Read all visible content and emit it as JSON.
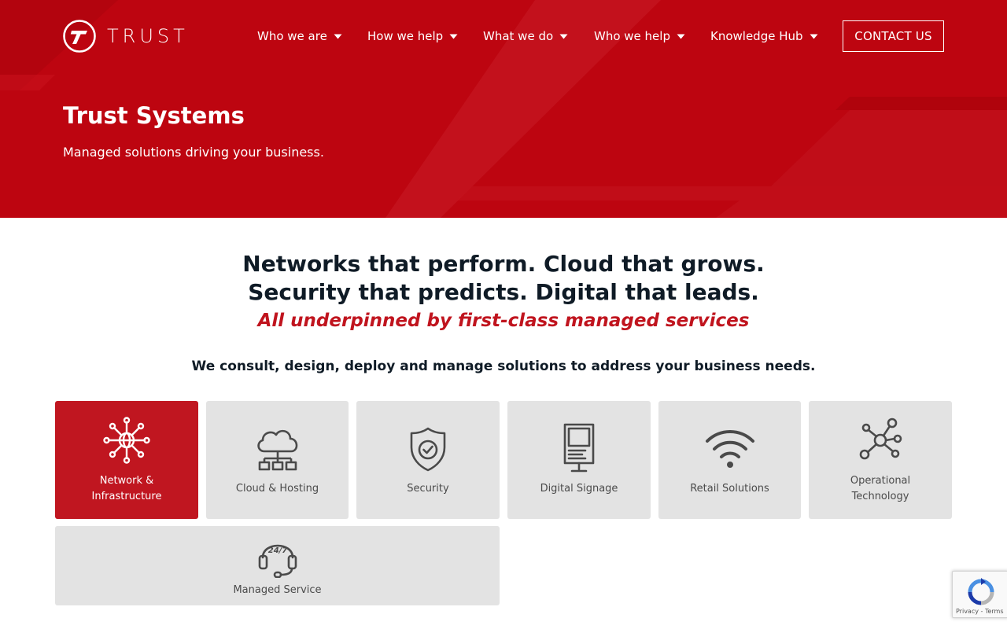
{
  "brand": {
    "name": "TRUST",
    "logo_icon": "trust-t-logo-icon",
    "color_primary": "#bd0510",
    "color_accent": "#c0141e"
  },
  "nav": {
    "items": [
      {
        "label": "Who we are",
        "icon": "caret-down-icon"
      },
      {
        "label": "How we help",
        "icon": "caret-down-icon"
      },
      {
        "label": "What we do",
        "icon": "caret-down-icon"
      },
      {
        "label": "Who we help",
        "icon": "caret-down-icon"
      },
      {
        "label": "Knowledge Hub",
        "icon": "caret-down-icon"
      }
    ],
    "contact_label": "CONTACT US"
  },
  "hero": {
    "title": "Trust Systems",
    "subtitle": "Managed solutions driving your business."
  },
  "headline": {
    "line1": "Networks that perform. Cloud that grows.",
    "line2": "Security that predicts. Digital that leads.",
    "tagline": "All underpinned by first-class managed services",
    "intro": "We consult, design, deploy and manage solutions to address your business needs."
  },
  "services": [
    {
      "line1": "Network &",
      "line2": "Infrastructure",
      "icon": "network-globe-icon",
      "active": true
    },
    {
      "line1": "Cloud & Hosting",
      "line2": "",
      "icon": "cloud-hosting-icon",
      "active": false
    },
    {
      "line1": "Security",
      "line2": "",
      "icon": "shield-check-icon",
      "active": false
    },
    {
      "line1": "Digital Signage",
      "line2": "",
      "icon": "kiosk-screen-icon",
      "active": false
    },
    {
      "line1": "Retail Solutions",
      "line2": "",
      "icon": "wifi-icon",
      "active": false
    },
    {
      "line1": "Operational",
      "line2": "Technology",
      "icon": "hub-nodes-icon",
      "active": false
    },
    {
      "line1": "Managed Service",
      "line2": "",
      "icon": "headset-24-7-icon",
      "active": false
    }
  ],
  "icon_texts": {
    "headset_badge": "24/7"
  },
  "recaptcha": {
    "links": "Privacy - Terms",
    "icon": "recaptcha-icon"
  }
}
